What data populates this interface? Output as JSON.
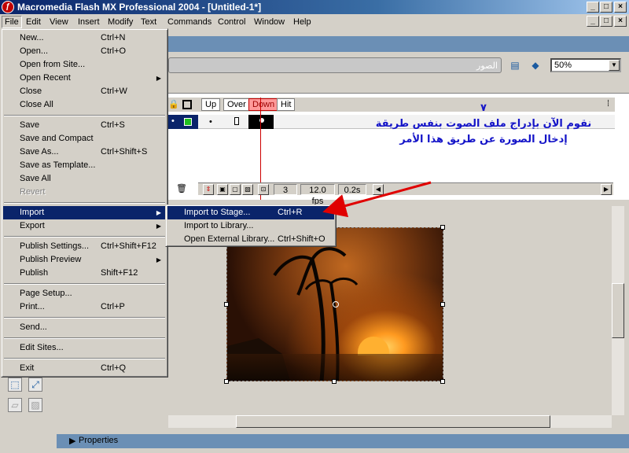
{
  "window": {
    "title": "Macromedia Flash MX Professional 2004 - [Untitled-1*]",
    "controls": [
      "_",
      "□",
      "×"
    ],
    "doc_controls": [
      "_",
      "□",
      "×"
    ]
  },
  "menubar": [
    "File",
    "Edit",
    "View",
    "Insert",
    "Modify",
    "Text",
    "Commands",
    "Control",
    "Window",
    "Help"
  ],
  "file_menu": {
    "groups": [
      [
        {
          "label": "New...",
          "shortcut": "Ctrl+N"
        },
        {
          "label": "Open...",
          "shortcut": "Ctrl+O"
        },
        {
          "label": "Open from Site...",
          "shortcut": ""
        },
        {
          "label": "Open Recent",
          "shortcut": "",
          "submenu": true
        },
        {
          "label": "Close",
          "shortcut": "Ctrl+W"
        },
        {
          "label": "Close All",
          "shortcut": ""
        }
      ],
      [
        {
          "label": "Save",
          "shortcut": "Ctrl+S"
        },
        {
          "label": "Save and Compact",
          "shortcut": ""
        },
        {
          "label": "Save As...",
          "shortcut": "Ctrl+Shift+S"
        },
        {
          "label": "Save as Template...",
          "shortcut": ""
        },
        {
          "label": "Save All",
          "shortcut": ""
        },
        {
          "label": "Revert",
          "shortcut": "",
          "disabled": true
        }
      ],
      [
        {
          "label": "Import",
          "shortcut": "",
          "submenu": true,
          "highlight": true
        },
        {
          "label": "Export",
          "shortcut": "",
          "submenu": true
        }
      ],
      [
        {
          "label": "Publish Settings...",
          "shortcut": "Ctrl+Shift+F12"
        },
        {
          "label": "Publish Preview",
          "shortcut": "",
          "submenu": true
        },
        {
          "label": "Publish",
          "shortcut": "Shift+F12"
        }
      ],
      [
        {
          "label": "Page Setup...",
          "shortcut": ""
        },
        {
          "label": "Print...",
          "shortcut": "Ctrl+P"
        }
      ],
      [
        {
          "label": "Send...",
          "shortcut": ""
        }
      ],
      [
        {
          "label": "Edit Sites...",
          "shortcut": ""
        }
      ],
      [
        {
          "label": "Exit",
          "shortcut": "Ctrl+Q"
        }
      ]
    ]
  },
  "import_submenu": [
    {
      "label": "Import to Stage...",
      "shortcut": "Ctrl+R",
      "highlight": true
    },
    {
      "label": "Import to Library...",
      "shortcut": ""
    },
    {
      "label": "Open External Library...",
      "shortcut": "Ctrl+Shift+O"
    }
  ],
  "timeline": {
    "scene_name": "الصور",
    "zoom": "50%",
    "frame_labels": [
      "Up",
      "Over",
      "Down",
      "Hit"
    ],
    "current_frame": "3",
    "fps": "12.0 fps",
    "time": "0.2s"
  },
  "annotation": {
    "number": "٧",
    "text": "نقوم الآن بإدراج ملف الصوت بنفس طريقة إدخال الصورة عن طريق هذا الأمر"
  },
  "properties": {
    "label": "Properties"
  },
  "colors": {
    "titlebar": "#0a246a",
    "highlight": "#0a246a",
    "annotation": "#1414c8",
    "arrow": "#e00000",
    "playhead": "#cc0000"
  },
  "icons": [
    "flash-app-icon",
    "lock-icon",
    "outline-icon",
    "trash-icon",
    "onion-skin-icon",
    "edit-scene-icon",
    "edit-symbol-icon",
    "zoom-dropdown-icon",
    "properties-expand-icon",
    "transform-icon",
    "fill-icon"
  ]
}
